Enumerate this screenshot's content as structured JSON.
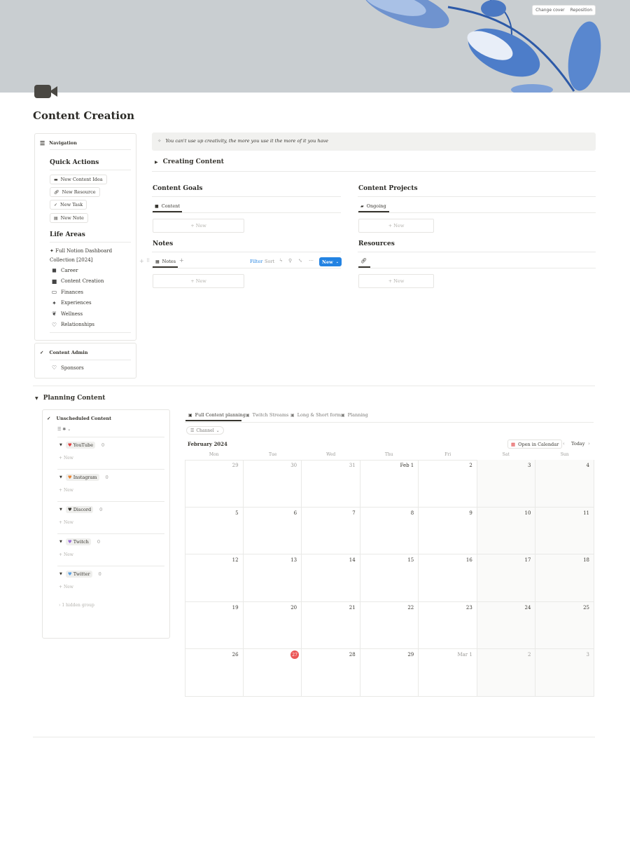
{
  "cover": {
    "change_label": "Change cover",
    "reposition_label": "Reposition"
  },
  "page": {
    "title": "Content Creation",
    "icon": "video-camera-icon"
  },
  "sidebar": {
    "nav_title": "Navigation",
    "quick_actions_title": "Quick Actions",
    "quick_actions": [
      {
        "label": "New Content Idea",
        "icon": "video-icon"
      },
      {
        "label": "New Resource",
        "icon": "link-icon"
      },
      {
        "label": "New Task",
        "icon": "check-icon"
      },
      {
        "label": "New Note",
        "icon": "note-icon"
      }
    ],
    "life_areas_title": "Life Areas",
    "life_areas": [
      {
        "label": "Full Notion Dashboard",
        "label2": "Collection [2024]",
        "icon": "sparkle-wand-icon"
      },
      {
        "label": "Career",
        "icon": "briefcase-icon"
      },
      {
        "label": "Content Creation",
        "icon": "video-camera-icon"
      },
      {
        "label": "Finances",
        "icon": "money-icon"
      },
      {
        "label": "Experiences",
        "icon": "sparkles-icon"
      },
      {
        "label": "Wellness",
        "icon": "leaf-icon"
      },
      {
        "label": "Relationships",
        "icon": "heart-icon"
      }
    ],
    "admin_title": "Content Admin",
    "admin_items": [
      {
        "label": "Sponsors",
        "icon": "heart-icon"
      }
    ]
  },
  "callout": {
    "text": "You can't use up creativity, the more you use it the more of it you have",
    "icon": "sparkles-icon"
  },
  "toggle": {
    "label": "Creating Content"
  },
  "content_goals": {
    "title": "Content Goals",
    "tab": "Content",
    "new_label": "New"
  },
  "content_projects": {
    "title": "Content Projects",
    "tab": "Ongoing",
    "new_label": "New"
  },
  "notes": {
    "title": "Notes",
    "tab": "Notes",
    "new_label": "New",
    "toolbar": {
      "filter": "Filter",
      "sort": "Sort",
      "new_btn": "New"
    }
  },
  "resources": {
    "title": "Resources",
    "new_label": "New"
  },
  "planning": {
    "title": "Planning Content",
    "unscheduled": {
      "title": "Unscheduled Content",
      "groups": [
        {
          "label": "YouTube",
          "count": "0",
          "color": "#e03e3e",
          "new_label": "New"
        },
        {
          "label": "Instagram",
          "count": "0",
          "color": "#e9822d",
          "new_label": "New"
        },
        {
          "label": "Discord",
          "count": "0",
          "color": "#37352f",
          "new_label": "New"
        },
        {
          "label": "Twitch",
          "count": "0",
          "color": "#9a6dd7",
          "new_label": "New"
        },
        {
          "label": "Twitter",
          "count": "0",
          "color": "#5aa1e3",
          "new_label": "New"
        }
      ],
      "hidden": "1 hidden group"
    },
    "tabs": [
      "Full Content planning",
      "Twitch Streams",
      "Long & Short form",
      "Planning"
    ],
    "filter_chip": "Channel",
    "calendar": {
      "month": "February 2024",
      "open_label": "Open in Calendar",
      "today_label": "Today",
      "weekdays": [
        "Mon",
        "Tue",
        "Wed",
        "Thu",
        "Fri",
        "Sat",
        "Sun"
      ],
      "weeks": [
        [
          "29",
          "30",
          "31",
          "Feb 1",
          "2",
          "3",
          "4"
        ],
        [
          "5",
          "6",
          "7",
          "8",
          "9",
          "10",
          "11"
        ],
        [
          "12",
          "13",
          "14",
          "15",
          "16",
          "17",
          "18"
        ],
        [
          "19",
          "20",
          "21",
          "22",
          "23",
          "24",
          "25"
        ],
        [
          "26",
          "27",
          "28",
          "29",
          "Mar 1",
          "2",
          "3"
        ]
      ],
      "today": "27",
      "today_color": "#eb5757"
    }
  }
}
